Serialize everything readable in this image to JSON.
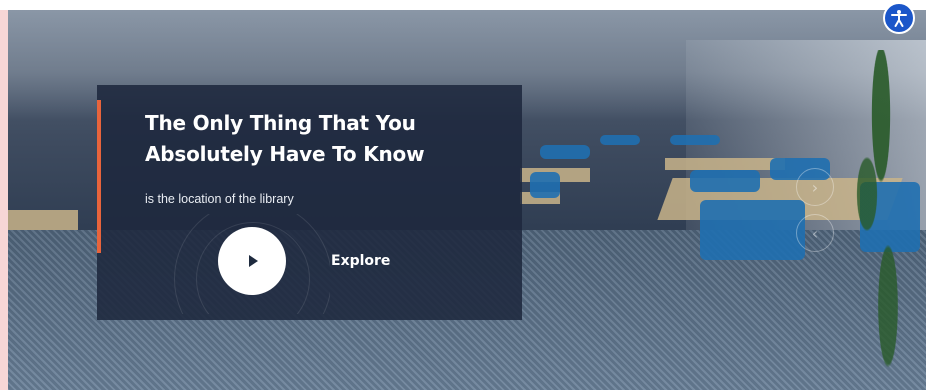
{
  "hero": {
    "title_line1": "The Only Thing That You",
    "title_line2": "Absolutely Have To Know",
    "subtitle": "is the location of the library",
    "explore_label": "Explore",
    "accent_color": "#e8643c",
    "card_color": "#1e283e"
  },
  "slider": {
    "next_arrow": "›",
    "prev_arrow": "‹"
  },
  "accessibility": {
    "icon": "accessibility-icon",
    "color": "#1b56c9"
  }
}
